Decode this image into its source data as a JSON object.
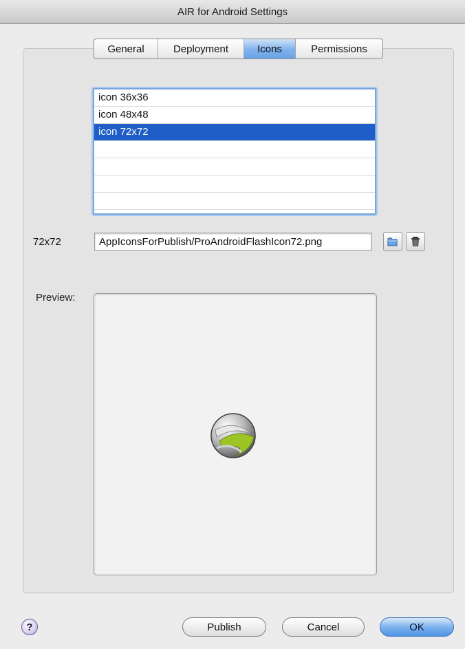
{
  "window": {
    "title": "AIR for Android Settings"
  },
  "tabs": [
    {
      "label": "General",
      "active": false
    },
    {
      "label": "Deployment",
      "active": false
    },
    {
      "label": "Icons",
      "active": true
    },
    {
      "label": "Permissions",
      "active": false
    }
  ],
  "icon_list": {
    "items": [
      "icon 36x36",
      "icon 48x48",
      "icon 72x72",
      "",
      "",
      "",
      ""
    ],
    "selected_index": 2
  },
  "icon_path": {
    "label": "72x72",
    "value": "AppIconsForPublish/ProAndroidFlashIcon72.png"
  },
  "buttons_icons": {
    "browse": "folder-icon",
    "delete": "trash-icon"
  },
  "preview": {
    "label": "Preview:"
  },
  "footer": {
    "help_label": "?",
    "publish_label": "Publish",
    "cancel_label": "Cancel",
    "ok_label": "OK"
  },
  "colors": {
    "selection": "#1e5ec6",
    "active_tab": "#7fb0ec",
    "default_button": "#4f93e6",
    "icon_accent": "#9cc425"
  }
}
